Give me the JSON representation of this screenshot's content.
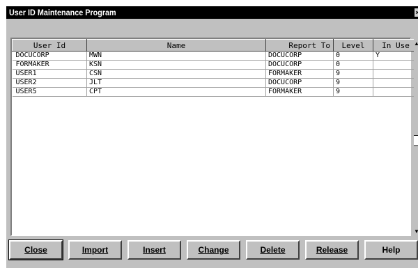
{
  "window": {
    "title": "User ID Maintenance Program"
  },
  "grid": {
    "columns": [
      "User Id",
      "Name",
      "Report To",
      "Level",
      "In Use"
    ],
    "rows": [
      {
        "user_id": "DOCUCORP",
        "name": "MWN",
        "report_to": "DOCUCORP",
        "level": "0",
        "in_use": "Y"
      },
      {
        "user_id": "FORMAKER",
        "name": "KSN",
        "report_to": "DOCUCORP",
        "level": "0",
        "in_use": ""
      },
      {
        "user_id": "USER1",
        "name": "CSN",
        "report_to": "FORMAKER",
        "level": "9",
        "in_use": ""
      },
      {
        "user_id": "USER2",
        "name": "JLT",
        "report_to": "DOCUCORP",
        "level": "9",
        "in_use": ""
      },
      {
        "user_id": "USER5",
        "name": "CPT",
        "report_to": "FORMAKER",
        "level": "9",
        "in_use": ""
      }
    ]
  },
  "buttons": {
    "close": "Close",
    "import": "Import",
    "insert": "Insert",
    "change": "Change",
    "delete": "Delete",
    "release": "Release",
    "help": "Help"
  },
  "icons": {
    "window_close": "close-icon",
    "scroll_up": "scroll-up-arrow-icon",
    "scroll_down": "scroll-down-arrow-icon"
  },
  "colors": {
    "titlebar": "#000000",
    "face": "#c0c0c0",
    "grid_background": "#ffffff"
  }
}
